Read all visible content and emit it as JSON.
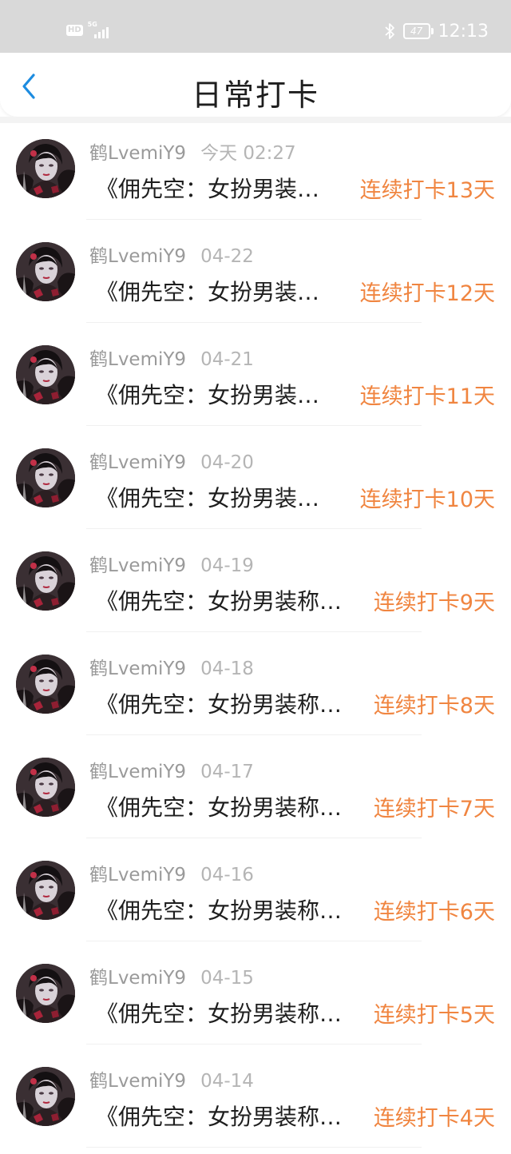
{
  "status_bar": {
    "hd_label": "HD",
    "network_label": "5G",
    "battery_level": "47",
    "time": "12:13",
    "icons": [
      "hd-icon",
      "signal-icon",
      "bluetooth-icon",
      "battery-icon"
    ]
  },
  "header": {
    "title": "日常打卡",
    "back_icon": "chevron-left-icon",
    "accent_color": "#1d8ce0"
  },
  "colors": {
    "streak": "#f08540",
    "username": "#9a9a9a",
    "date": "#b5b5b5",
    "title_text": "#1e1e1e"
  },
  "checkins": [
    {
      "username": "鹤LvemiY9",
      "date": "今天 02:27",
      "title": "《佣先空：女扮男装…",
      "streak": "连续打卡13天"
    },
    {
      "username": "鹤LvemiY9",
      "date": "04-22",
      "title": "《佣先空：女扮男装…",
      "streak": "连续打卡12天"
    },
    {
      "username": "鹤LvemiY9",
      "date": "04-21",
      "title": "《佣先空：女扮男装…",
      "streak": "连续打卡11天"
    },
    {
      "username": "鹤LvemiY9",
      "date": "04-20",
      "title": "《佣先空：女扮男装…",
      "streak": "连续打卡10天"
    },
    {
      "username": "鹤LvemiY9",
      "date": "04-19",
      "title": "《佣先空：女扮男装称…",
      "streak": "连续打卡9天"
    },
    {
      "username": "鹤LvemiY9",
      "date": "04-18",
      "title": "《佣先空：女扮男装称…",
      "streak": "连续打卡8天"
    },
    {
      "username": "鹤LvemiY9",
      "date": "04-17",
      "title": "《佣先空：女扮男装称…",
      "streak": "连续打卡7天"
    },
    {
      "username": "鹤LvemiY9",
      "date": "04-16",
      "title": "《佣先空：女扮男装称…",
      "streak": "连续打卡6天"
    },
    {
      "username": "鹤LvemiY9",
      "date": "04-15",
      "title": "《佣先空：女扮男装称…",
      "streak": "连续打卡5天"
    },
    {
      "username": "鹤LvemiY9",
      "date": "04-14",
      "title": "《佣先空：女扮男装称…",
      "streak": "连续打卡4天"
    }
  ]
}
